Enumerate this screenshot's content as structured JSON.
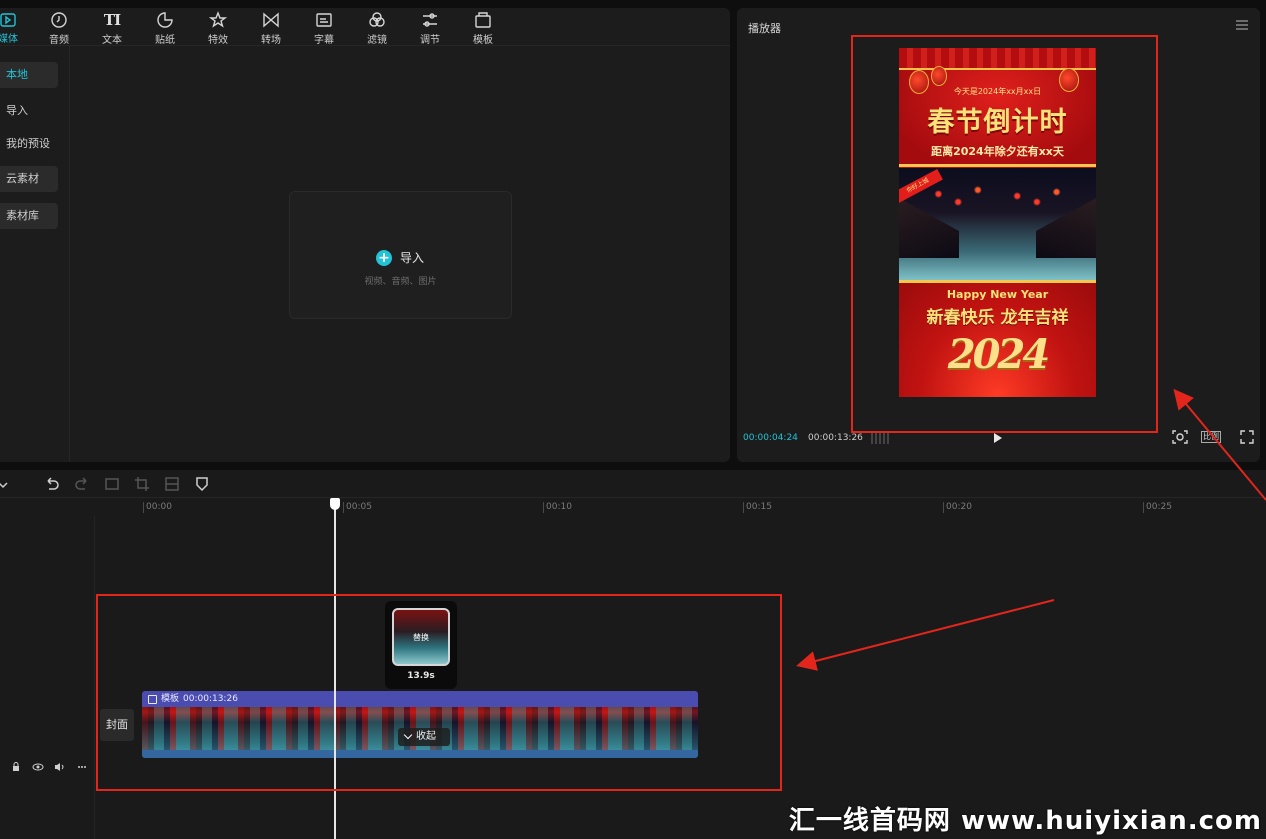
{
  "toolbar": {
    "items": [
      {
        "label": "媒体",
        "icon": "media-icon"
      },
      {
        "label": "音频",
        "icon": "audio-icon"
      },
      {
        "label": "文本",
        "icon": "text-icon"
      },
      {
        "label": "贴纸",
        "icon": "sticker-icon"
      },
      {
        "label": "特效",
        "icon": "effects-icon"
      },
      {
        "label": "转场",
        "icon": "transition-icon"
      },
      {
        "label": "字幕",
        "icon": "subtitle-icon"
      },
      {
        "label": "滤镜",
        "icon": "filter-icon"
      },
      {
        "label": "调节",
        "icon": "adjust-icon"
      },
      {
        "label": "模板",
        "icon": "template-icon"
      }
    ],
    "text_glyph": "TI"
  },
  "sidebar": {
    "items": [
      {
        "label": "本地"
      },
      {
        "label": "导入"
      },
      {
        "label": "我的预设"
      },
      {
        "label": "云素材"
      },
      {
        "label": "素材库"
      }
    ]
  },
  "import_panel": {
    "label": "导入",
    "subtitle": "视频、音频、图片"
  },
  "player": {
    "title": "播放器",
    "current_time": "00:00:04:24",
    "total_time": "00:00:13:26",
    "ratio_label": "比例",
    "poster": {
      "date_line": "今天是2024年xx月xx日",
      "headline": "春节倒计时",
      "countdown": "距离2024年除夕还有xx天",
      "ribbon": "你好上城",
      "english": "Happy New Year",
      "greeting": "新春快乐 龙年吉祥",
      "year": "2024"
    }
  },
  "timeline": {
    "ruler_labels": [
      "00:00",
      "00:05",
      "00:10",
      "00:15",
      "00:20",
      "00:25"
    ],
    "cover_label": "封面",
    "clip": {
      "tag": "模板",
      "duration": "00:00:13:26",
      "collapse_label": "收起"
    },
    "thumb": {
      "replace_label": "替换",
      "duration": "13.9s"
    },
    "track_controls": [
      "lock-icon",
      "eye-icon",
      "volume-icon",
      "more-icon"
    ]
  },
  "watermark": "汇一线首码网 www.huiyixian.com",
  "colors": {
    "accent": "#22c3d6",
    "annotation_red": "#e3261c",
    "clip_header": "#4a4cb0"
  }
}
